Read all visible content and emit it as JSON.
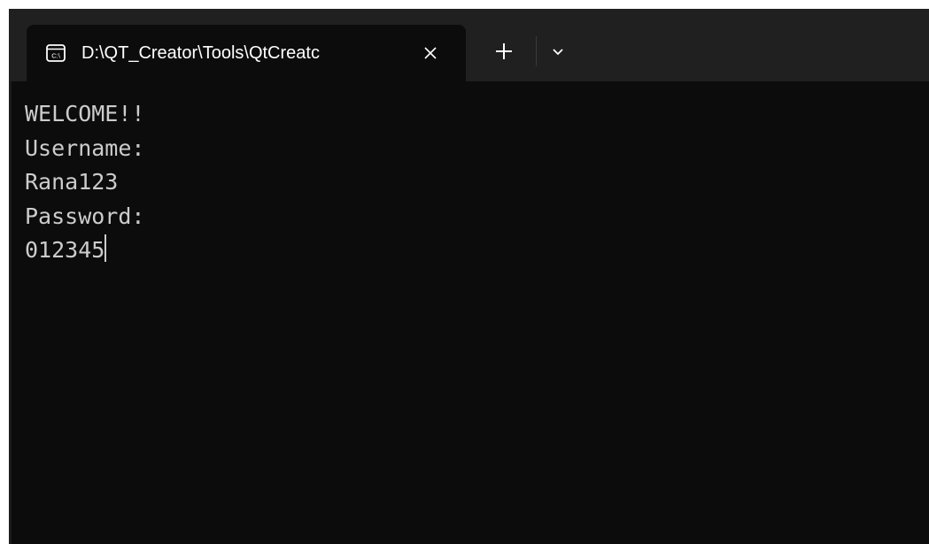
{
  "tab": {
    "icon": "command-prompt-icon",
    "title": "D:\\QT_Creator\\Tools\\QtCreatc"
  },
  "toolbar": {
    "close_icon": "close-icon",
    "new_tab_icon": "plus-icon",
    "dropdown_icon": "chevron-down-icon"
  },
  "console": {
    "lines": [
      "WELCOME!!",
      "Username:",
      "Rana123",
      "Password:",
      "012345"
    ]
  },
  "colors": {
    "background": "#0c0c0c",
    "titlebar": "#202020",
    "text": "#cccccc"
  }
}
